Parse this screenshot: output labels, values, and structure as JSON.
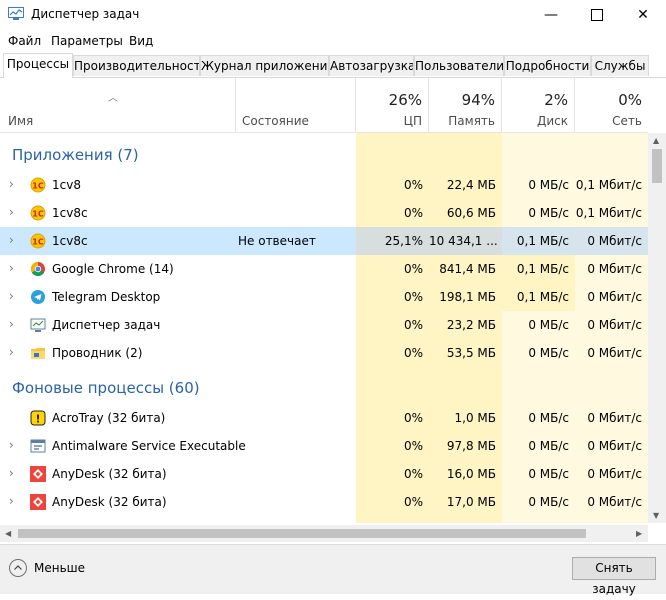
{
  "window": {
    "title": "Диспетчер задач"
  },
  "menu": [
    {
      "label": "Файл"
    },
    {
      "label": "Параметры"
    },
    {
      "label": "Вид"
    }
  ],
  "tabs": [
    {
      "label": "Процессы",
      "active": true
    },
    {
      "label": "Производительность"
    },
    {
      "label": "Журнал приложений"
    },
    {
      "label": "Автозагрузка"
    },
    {
      "label": "Пользователи"
    },
    {
      "label": "Подробности"
    },
    {
      "label": "Службы"
    }
  ],
  "columns": {
    "name": "Имя",
    "status": "Состояние",
    "cpu": {
      "pct": "26%",
      "label": "ЦП"
    },
    "mem": {
      "pct": "94%",
      "label": "Память"
    },
    "disk": {
      "pct": "2%",
      "label": "Диск"
    },
    "net": {
      "pct": "0%",
      "label": "Сеть"
    }
  },
  "groups": {
    "apps": "Приложения (7)",
    "background": "Фоновые процессы (60)"
  },
  "apps": [
    {
      "name": "1cv8",
      "status": "",
      "cpu": "0%",
      "mem": "22,4 МБ",
      "disk": "0 МБ/с",
      "net": "0,1 Мбит/с",
      "icon": "1c-icon"
    },
    {
      "name": "1cv8c",
      "status": "",
      "cpu": "0%",
      "mem": "60,6 МБ",
      "disk": "0 МБ/с",
      "net": "0,1 Мбит/с",
      "icon": "1c-icon"
    },
    {
      "name": "1cv8c",
      "status": "Не отвечает",
      "cpu": "25,1%",
      "mem": "10 434,1 ...",
      "disk": "0,1 МБ/с",
      "net": "0 Мбит/с",
      "icon": "1c-icon",
      "selected": true
    },
    {
      "name": "Google Chrome (14)",
      "status": "",
      "cpu": "0%",
      "mem": "841,4 МБ",
      "disk": "0,1 МБ/с",
      "net": "0 Мбит/с",
      "icon": "chrome-icon"
    },
    {
      "name": "Telegram Desktop",
      "status": "",
      "cpu": "0%",
      "mem": "198,1 МБ",
      "disk": "0,1 МБ/с",
      "net": "0 Мбит/с",
      "icon": "telegram-icon"
    },
    {
      "name": "Диспетчер задач",
      "status": "",
      "cpu": "0%",
      "mem": "23,2 МБ",
      "disk": "0 МБ/с",
      "net": "0 Мбит/с",
      "icon": "taskmgr-icon"
    },
    {
      "name": "Проводник (2)",
      "status": "",
      "cpu": "0%",
      "mem": "53,5 МБ",
      "disk": "0 МБ/с",
      "net": "0 Мбит/с",
      "icon": "explorer-icon"
    }
  ],
  "background": [
    {
      "name": "AcroTray (32 бита)",
      "status": "",
      "cpu": "0%",
      "mem": "1,0 МБ",
      "disk": "0 МБ/с",
      "net": "0 Мбит/с",
      "icon": "acrotray-icon",
      "expandable": false
    },
    {
      "name": "Antimalware Service Executable",
      "status": "",
      "cpu": "0%",
      "mem": "97,8 МБ",
      "disk": "0 МБ/с",
      "net": "0 Мбит/с",
      "icon": "service-icon",
      "expandable": true
    },
    {
      "name": "AnyDesk (32 бита)",
      "status": "",
      "cpu": "0%",
      "mem": "16,0 МБ",
      "disk": "0 МБ/с",
      "net": "0 Мбит/с",
      "icon": "anydesk-icon",
      "expandable": true
    },
    {
      "name": "AnyDesk (32 бита)",
      "status": "",
      "cpu": "0%",
      "mem": "17,0 МБ",
      "disk": "0 МБ/с",
      "net": "0 Мбит/с",
      "icon": "anydesk-icon",
      "expandable": true
    }
  ],
  "footer": {
    "less": "Меньше",
    "end_task": "Снять задачу"
  },
  "colors": {
    "heat_light": "#fff9e0",
    "heat_mid": "#fff4c4",
    "selected": "#cce8ff",
    "group": "#2b63a8"
  }
}
